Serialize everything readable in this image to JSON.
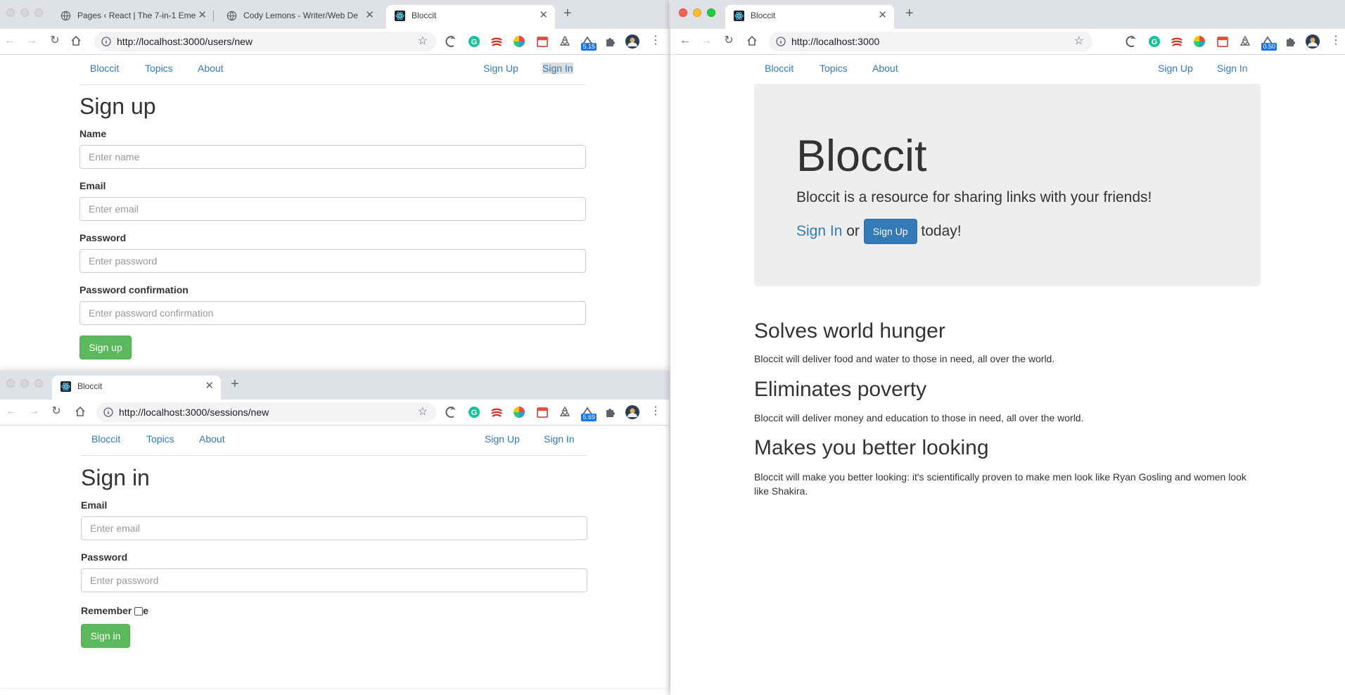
{
  "colors": {
    "link": "#337ab7",
    "success": "#5cb85c",
    "primary": "#337ab7",
    "jumbotron": "#eeeeee"
  },
  "win_a": {
    "tabs": [
      {
        "title": "Pages ‹ React | The 7-in-1 Eme",
        "icon": "globe-icon"
      },
      {
        "title": "Cody Lemons - Writer/Web De",
        "icon": "globe-icon"
      },
      {
        "title": "Bloccit",
        "icon": "react-icon"
      }
    ],
    "url": "http://localhost:3000/users/new",
    "badge": "5.15",
    "nav": {
      "brand": "Bloccit",
      "topics": "Topics",
      "about": "About",
      "signup": "Sign Up",
      "signin": "Sign In"
    },
    "heading": "Sign up",
    "fields": [
      {
        "label": "Name",
        "placeholder": "Enter name"
      },
      {
        "label": "Email",
        "placeholder": "Enter email"
      },
      {
        "label": "Password",
        "placeholder": "Enter password"
      },
      {
        "label": "Password confirmation",
        "placeholder": "Enter password confirmation"
      }
    ],
    "submit": "Sign up"
  },
  "win_b": {
    "tabs": [
      {
        "title": "Bloccit",
        "icon": "react-icon"
      }
    ],
    "url": "http://localhost:3000/sessions/new",
    "badge": "5.69",
    "nav": {
      "brand": "Bloccit",
      "topics": "Topics",
      "about": "About",
      "signup": "Sign Up",
      "signin": "Sign In"
    },
    "heading": "Sign in",
    "fields": [
      {
        "label": "Email",
        "placeholder": "Enter email"
      },
      {
        "label": "Password",
        "placeholder": "Enter password"
      }
    ],
    "remember_left": "Remember ",
    "remember_right": "e",
    "submit": "Sign in"
  },
  "win_c": {
    "tabs": [
      {
        "title": "Bloccit",
        "icon": "react-icon"
      }
    ],
    "url": "http://localhost:3000",
    "badge": "0.50",
    "nav": {
      "brand": "Bloccit",
      "topics": "Topics",
      "about": "About",
      "signup": "Sign Up",
      "signin": "Sign In"
    },
    "jumbotron": {
      "title": "Bloccit",
      "lead": "Bloccit is a resource for sharing links with your friends!",
      "signin": "Sign In",
      "or": "or",
      "signup": "Sign Up",
      "today": "today!"
    },
    "features": [
      {
        "heading": "Solves world hunger",
        "text": "Bloccit will deliver food and water to those in need, all over the world."
      },
      {
        "heading": "Eliminates poverty",
        "text": "Bloccit will deliver money and education to those in need, all over the world."
      },
      {
        "heading": "Makes you better looking",
        "text": "Bloccit will make you better looking: it's scientifically proven to make men look like Ryan Gosling and women look like Shakira."
      }
    ]
  }
}
